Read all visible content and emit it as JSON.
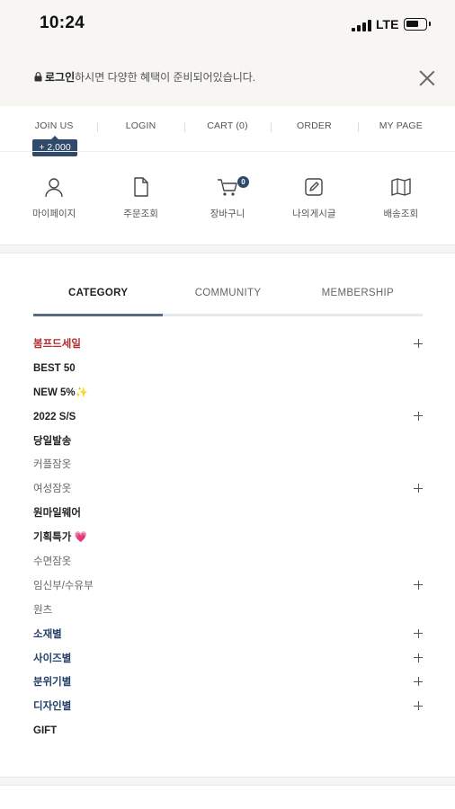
{
  "status_bar": {
    "time": "10:24",
    "network": "LTE",
    "battery_level": 0.55
  },
  "notice": {
    "login_link": "로그인",
    "message": "하시면 다양한 혜택이 준비되어있습니다."
  },
  "top_links": [
    "JOIN US",
    "LOGIN",
    "CART (0)",
    "ORDER",
    "MY PAGE"
  ],
  "join_badge": "+ 2,000",
  "quick_menu": [
    {
      "label": "마이페이지",
      "icon": "person-icon"
    },
    {
      "label": "주문조회",
      "icon": "document-icon"
    },
    {
      "label": "장바구니",
      "icon": "cart-icon"
    },
    {
      "label": "나의게시글",
      "icon": "edit-icon"
    },
    {
      "label": "배송조회",
      "icon": "map-icon"
    }
  ],
  "cart_badge": "0",
  "tabs": [
    "CATEGORY",
    "COMMUNITY",
    "MEMBERSHIP"
  ],
  "active_tab": "CATEGORY",
  "categories": [
    {
      "label": "봄프드세일",
      "style": "red",
      "expandable": true
    },
    {
      "label": "BEST 50",
      "style": "bold",
      "expandable": false
    },
    {
      "label": "NEW 5%✨",
      "style": "bold",
      "expandable": false
    },
    {
      "label": "2022 S/S",
      "style": "bold",
      "expandable": true
    },
    {
      "label": "당일발송",
      "style": "bold",
      "expandable": false
    },
    {
      "label": "커플잠옷",
      "style": "light",
      "expandable": false
    },
    {
      "label": "여성잠옷",
      "style": "light",
      "expandable": true
    },
    {
      "label": "원마일웨어",
      "style": "bold",
      "expandable": false
    },
    {
      "label": "기획특가 💗",
      "style": "bold",
      "expandable": false
    },
    {
      "label": "수면잠옷",
      "style": "light",
      "expandable": false
    },
    {
      "label": "임신부/수유부",
      "style": "light",
      "expandable": true
    },
    {
      "label": "원츠",
      "style": "light",
      "expandable": false
    },
    {
      "label": "소재별",
      "style": "navy",
      "expandable": true
    },
    {
      "label": "사이즈별",
      "style": "navy",
      "expandable": true
    },
    {
      "label": "분위기별",
      "style": "navy",
      "expandable": true
    },
    {
      "label": "디자인별",
      "style": "navy",
      "expandable": true
    },
    {
      "label": "GIFT",
      "style": "bold",
      "expandable": false
    }
  ],
  "colors": {
    "accent_navy": "#2f4a6b",
    "sale_red": "#b42e2e",
    "category_navy": "#24406b"
  }
}
